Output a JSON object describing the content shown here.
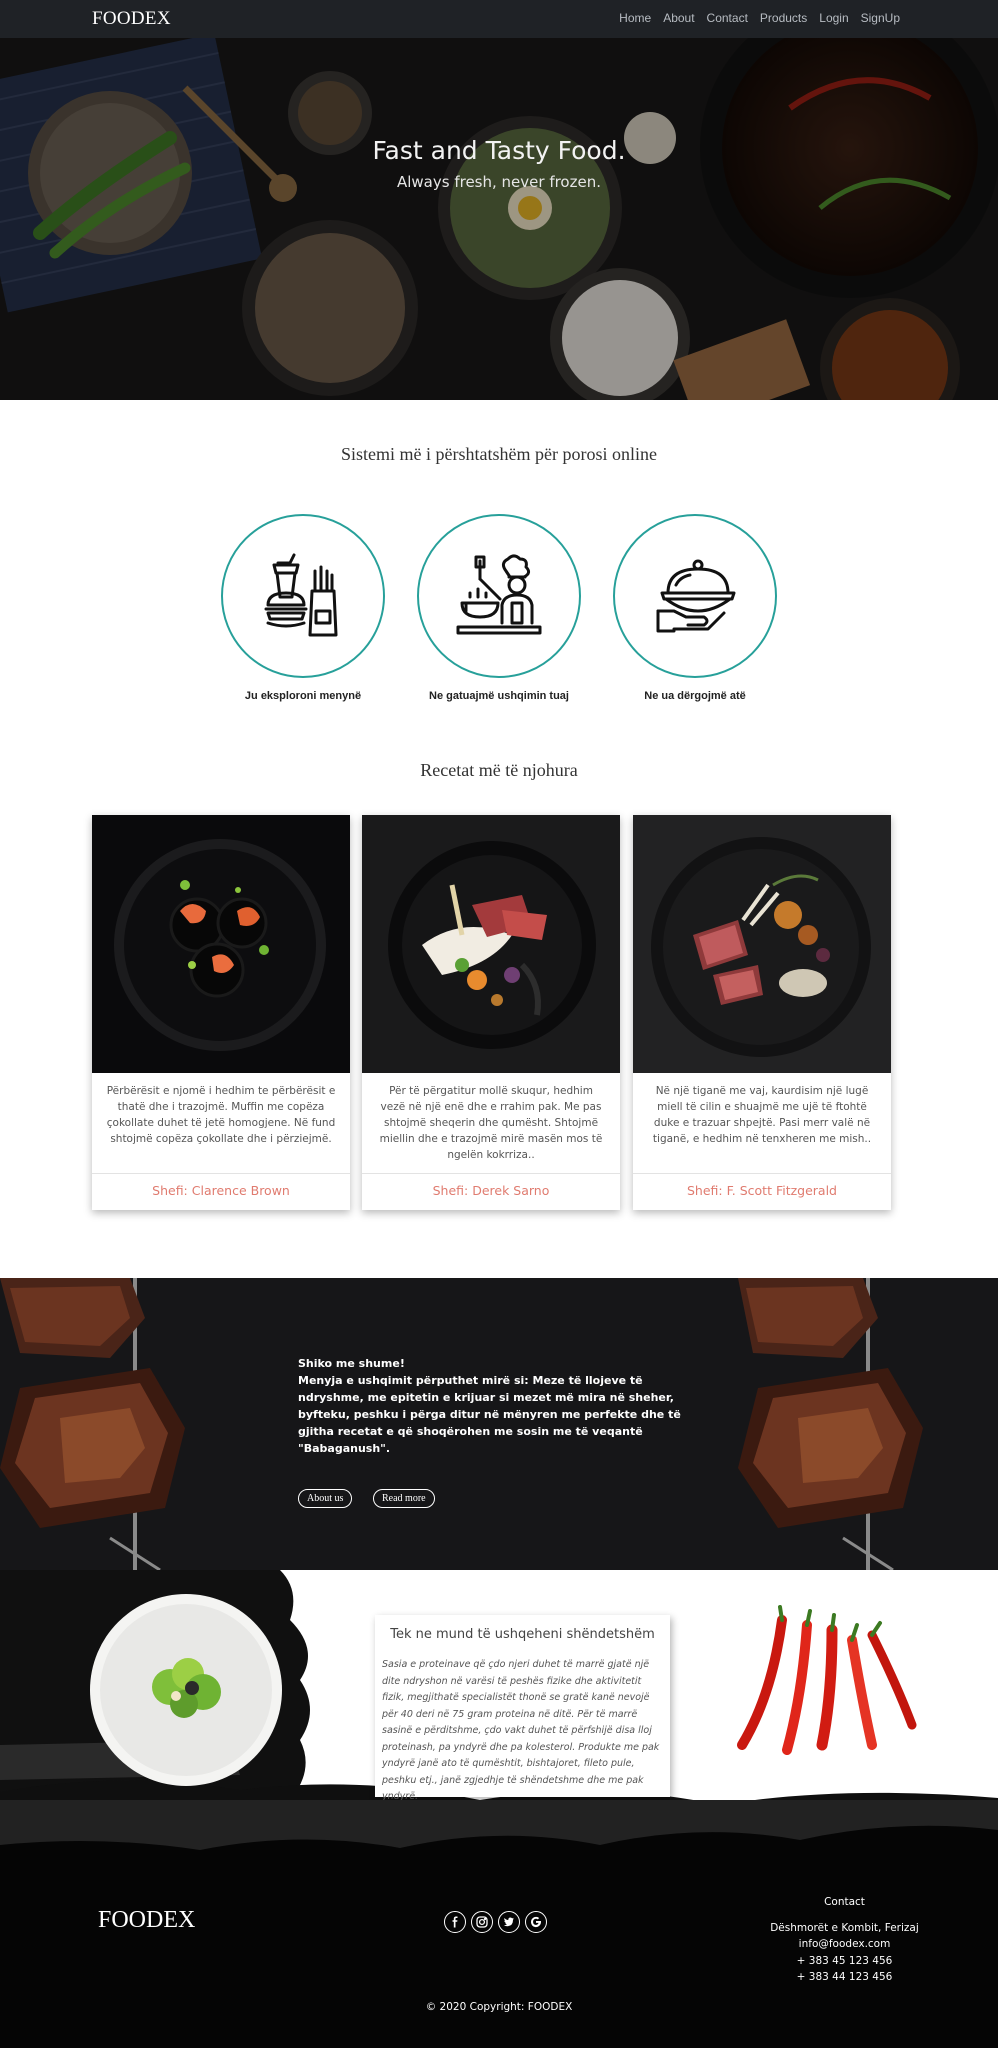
{
  "nav": {
    "brand": "FOODEX",
    "links": [
      "Home",
      "About",
      "Contact",
      "Products",
      "Login",
      "SignUp"
    ]
  },
  "hero": {
    "title": "Fast and Tasty Food.",
    "subtitle": "Always fresh, never frozen."
  },
  "features": {
    "title": "Sistemi më i përshtatshëm për porosi online",
    "steps": [
      {
        "label": "Ju eksploroni menynë",
        "icon": "fast-food-icon"
      },
      {
        "label": "Ne gatuajmë ushqimin tuaj",
        "icon": "chef-icon"
      },
      {
        "label": "Ne ua dërgojmë atë",
        "icon": "serving-cloche-icon"
      }
    ]
  },
  "recipes": {
    "title": "Recetat më të njohura",
    "cards": [
      {
        "text": "Përbërësit e njomë i hedhim te përbërësit e thatë dhe i trazojmë. Muffin me copëza çokollate duhet të jetë homogjene. Në fund shtojmë copëza çokollate dhe i përziejmë.",
        "chef": "Shefi: Clarence Brown"
      },
      {
        "text": "Për të përgatitur mollë skuqur, hedhim vezë në një enë dhe e rrahim pak. Me pas shtojmë sheqerin dhe qumësht. Shtojmë miellin dhe e trazojmë mirë masën mos të ngelën kokrriza..",
        "chef": "Shefi: Derek Sarno"
      },
      {
        "text": "Në një tiganë me vaj, kaurdisim një lugë miell të cilin e shuajmë me ujë të ftohtë duke e trazuar shpejtë. Pasi merr valë në tiganë, e hedhim në tenxheren me mish..",
        "chef": "Shefi: F. Scott Fitzgerald"
      }
    ]
  },
  "band": {
    "heading": "Shiko me shume!",
    "text": "Menyja e ushqimit përputhet mirë si: Meze të llojeve të ndryshme, me epitetin e krijuar si mezet më mira në sheher, byfteku, peshku i përga ditur në mënyren me perfekte dhe të gjitha recetat e që shoqërohen me sosin me të veqantë \"Babaganush\".",
    "buttons": {
      "about": "About us",
      "read_more": "Read more"
    }
  },
  "health": {
    "title": "Tek ne mund të ushqeheni shëndetshëm",
    "text": "Sasia e proteinave që çdo njeri duhet të marrë gjatë një dite ndryshon në varësi të peshës fizike dhe aktivitetit fizik, megjithatë specialistët thonë se gratë kanë nevojë për 40 deri në 75 gram proteina në ditë. Për të marrë sasinë e përditshme, çdo vakt duhet të përfshijë disa lloj proteinash, pa yndyrë dhe pa kolesterol. Produkte me pak yndyrë janë ato të qumështit, bishtajoret, fileto pule, peshku etj., janë zgjedhje të shëndetshme dhe me pak yndyrë."
  },
  "footer": {
    "brand": "FOODEX",
    "social_icons": [
      "facebook-icon",
      "instagram-icon",
      "twitter-icon",
      "google-icon"
    ],
    "contact": {
      "title": "Contact",
      "address": "Dëshmorët e Kombit, Ferizaj",
      "email": "info@foodex.com",
      "phone1": "+ 383 45 123 456",
      "phone2": "+ 383 44 123 456"
    },
    "copyright": "© 2020 Copyright: FOODEX"
  },
  "colors": {
    "nav_bg": "#1f2226",
    "accent_teal": "#27a09a",
    "chef_text": "#e07b6f",
    "band_bg": "#161618",
    "footer_bg": "#050505"
  }
}
